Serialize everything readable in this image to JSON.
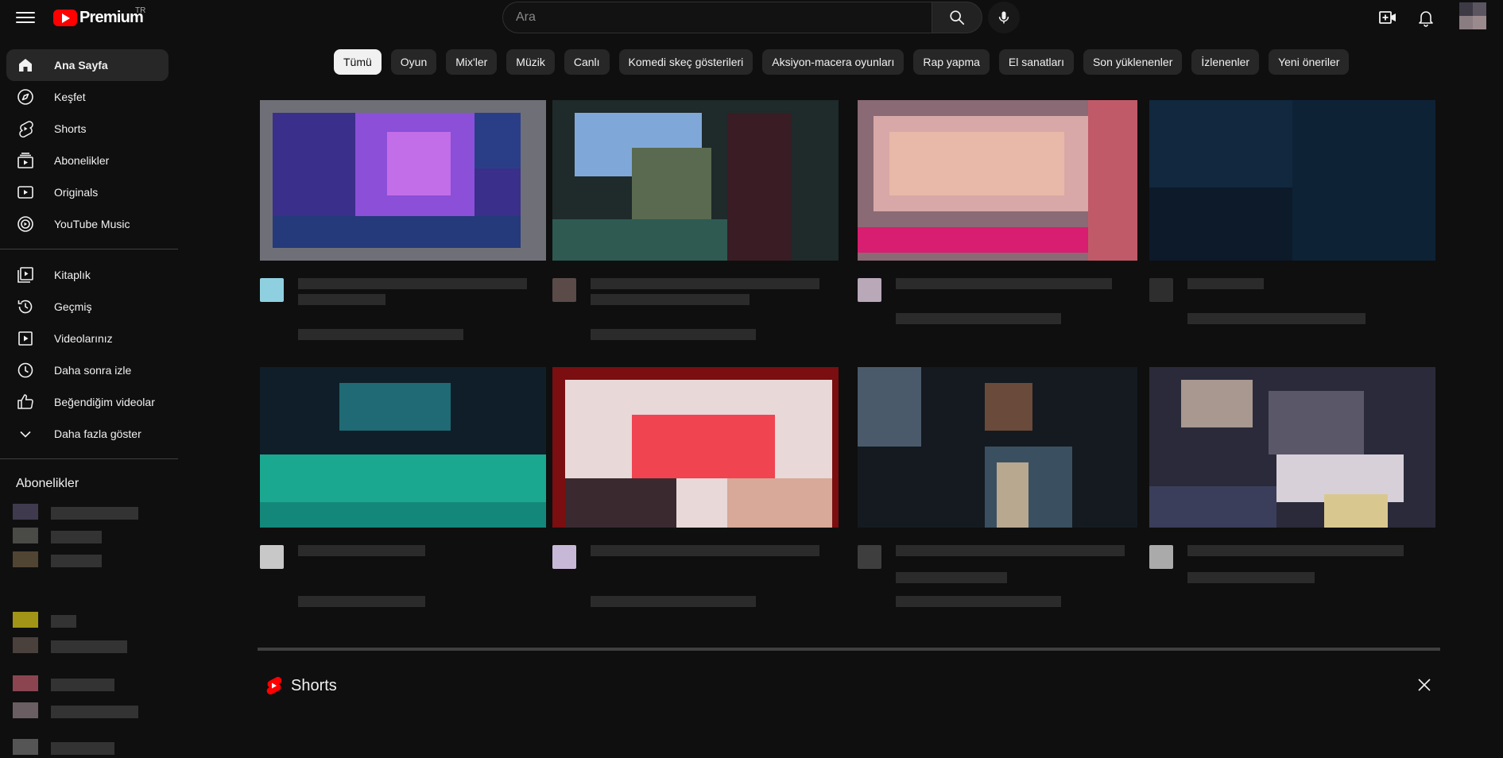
{
  "header": {
    "logo_text": "Premium",
    "country_code": "TR",
    "search_placeholder": "Ara"
  },
  "sidebar": {
    "main": [
      {
        "label": "Ana Sayfa",
        "icon": "home-icon",
        "active": true
      },
      {
        "label": "Keşfet",
        "icon": "compass-icon"
      },
      {
        "label": "Shorts",
        "icon": "shorts-icon"
      },
      {
        "label": "Abonelikler",
        "icon": "subscriptions-icon"
      },
      {
        "label": "Originals",
        "icon": "originals-icon"
      },
      {
        "label": "YouTube Music",
        "icon": "music-icon"
      }
    ],
    "library": [
      {
        "label": "Kitaplık",
        "icon": "library-icon"
      },
      {
        "label": "Geçmiş",
        "icon": "history-icon"
      },
      {
        "label": "Videolarınız",
        "icon": "your-videos-icon"
      },
      {
        "label": "Daha sonra izle",
        "icon": "watch-later-icon"
      },
      {
        "label": "Beğendiğim videolar",
        "icon": "thumb-up-icon"
      },
      {
        "label": "Daha fazla göster",
        "icon": "chevron-down-icon"
      }
    ],
    "subscriptions_title": "Abonelikler"
  },
  "chips": [
    "Tümü",
    "Oyun",
    "Mix'ler",
    "Müzik",
    "Canlı",
    "Komedi skeç gösterileri",
    "Aksiyon-macera oyunları",
    "Rap yapma",
    "El sanatları",
    "Son yüklenenler",
    "İzlenenler",
    "Yeni öneriler"
  ],
  "active_chip": "Tümü",
  "shorts": {
    "title": "Shorts"
  },
  "colors": {
    "background": "#0f0f0f",
    "brand_red": "#ff0000",
    "chip_bg": "#272727",
    "chip_active_bg": "#f1f1f1"
  }
}
